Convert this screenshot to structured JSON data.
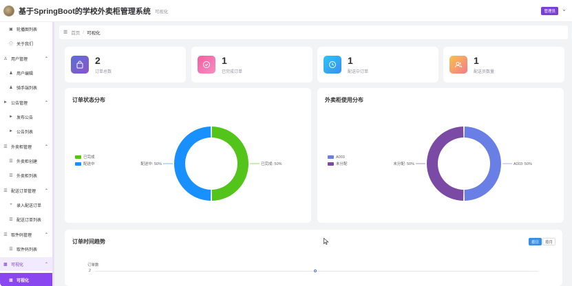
{
  "header": {
    "title": "基于SpringBoot的学校外卖柜管理系统",
    "subtitle": "可视化",
    "role_badge": "管理员"
  },
  "sidebar": {
    "items": [
      {
        "label": "轮播图列表",
        "icon": "image-icon",
        "kind": "child"
      },
      {
        "label": "关于我们",
        "icon": "info-icon",
        "kind": "child"
      },
      {
        "label": "用户管理",
        "icon": "users-icon",
        "kind": "group"
      },
      {
        "label": "用户编辑",
        "icon": "user-icon",
        "kind": "child"
      },
      {
        "label": "骑手端列表",
        "icon": "user-icon",
        "kind": "child"
      },
      {
        "label": "公告管理",
        "icon": "megaphone-icon",
        "kind": "group"
      },
      {
        "label": "发布公告",
        "icon": "megaphone-icon",
        "kind": "child"
      },
      {
        "label": "公告列表",
        "icon": "megaphone-icon",
        "kind": "child"
      },
      {
        "label": "外卖柜管理",
        "icon": "list-icon",
        "kind": "group"
      },
      {
        "label": "外卖柜创建",
        "icon": "list-icon",
        "kind": "child"
      },
      {
        "label": "外卖柜列表",
        "icon": "list-icon",
        "kind": "child"
      },
      {
        "label": "配送订单管理",
        "icon": "list-icon",
        "kind": "group"
      },
      {
        "label": "录入配送订单",
        "icon": "plus-icon",
        "kind": "child"
      },
      {
        "label": "配送订单列表",
        "icon": "list-icon",
        "kind": "child"
      },
      {
        "label": "取件码管理",
        "icon": "list-icon",
        "kind": "group"
      },
      {
        "label": "取件码列表",
        "icon": "list-icon",
        "kind": "child"
      },
      {
        "label": "可视化",
        "icon": "bar-chart-icon",
        "kind": "group-active"
      },
      {
        "label": "可视化",
        "icon": "bar-chart-icon",
        "kind": "item-active"
      }
    ]
  },
  "breadcrumb": {
    "home": "首页",
    "sep": "/",
    "current": "可视化"
  },
  "stats": [
    {
      "value": "2",
      "label": "订单总数",
      "icon": "bag-icon",
      "color_a": "#5b6fd6",
      "color_b": "#8a55c9"
    },
    {
      "value": "1",
      "label": "已完成订单",
      "icon": "check-circle-icon",
      "color_a": "#f15fa0",
      "color_b": "#f58fc0"
    },
    {
      "value": "1",
      "label": "配送中订单",
      "icon": "clock-icon",
      "color_a": "#2ec5f5",
      "color_b": "#3a8ef0"
    },
    {
      "value": "1",
      "label": "配送员数量",
      "icon": "users-icon",
      "color_a": "#f7c24c",
      "color_b": "#f47a8c"
    }
  ],
  "charts": {
    "order_status_title": "订单状态分布",
    "locker_usage_title": "外卖柜使用分布",
    "trend_title": "订单时间趋势",
    "trend_toggle": {
      "active": "按日",
      "inactive": "按月"
    }
  },
  "chart_data": [
    {
      "type": "pie",
      "title": "订单状态分布",
      "legend_position": "left",
      "slices": [
        {
          "name": "已完成",
          "value": 50,
          "label": "已完成: 50%",
          "color": "#52c41a"
        },
        {
          "name": "配送中",
          "value": 50,
          "label": "配送中: 50%",
          "color": "#1890ff"
        }
      ]
    },
    {
      "type": "pie",
      "title": "外卖柜使用分布",
      "legend_position": "left",
      "slices": [
        {
          "name": "A003",
          "value": 50,
          "label": "A003: 50%",
          "color": "#6a7fe5"
        },
        {
          "name": "未分配",
          "value": 50,
          "label": "未分配: 50%",
          "color": "#7b4aa5"
        }
      ]
    },
    {
      "type": "line",
      "title": "订单时间趋势",
      "ylabel": "订单数",
      "y_ticks": [
        "2"
      ],
      "series": [
        {
          "values": [
            2
          ]
        }
      ],
      "grid": true
    }
  ]
}
